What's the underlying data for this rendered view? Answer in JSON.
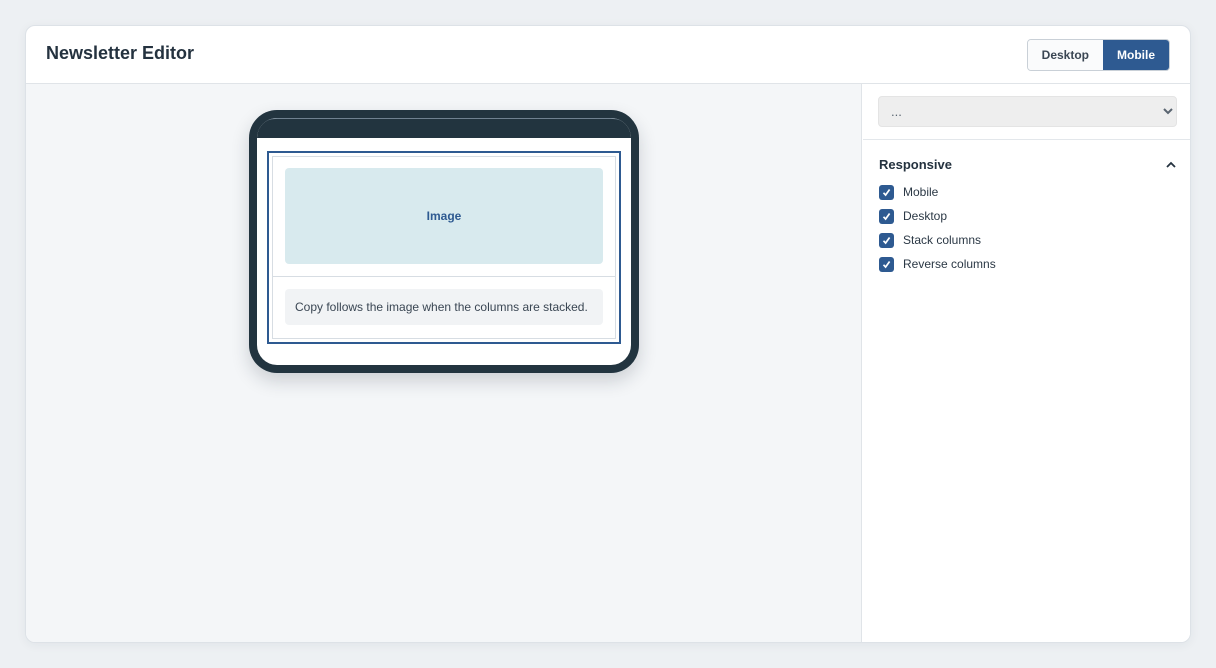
{
  "header": {
    "title": "Newsletter Editor",
    "view_toggle": {
      "desktop_label": "Desktop",
      "mobile_label": "Mobile",
      "active": "Mobile"
    }
  },
  "canvas": {
    "block": {
      "image_label": "Image",
      "copy_text": "Copy follows the image when the columns are stacked."
    }
  },
  "sidebar": {
    "block_select": {
      "value": "..."
    },
    "responsive": {
      "title": "Responsive",
      "options": [
        {
          "label": "Mobile",
          "checked": true
        },
        {
          "label": "Desktop",
          "checked": true
        },
        {
          "label": "Stack columns",
          "checked": true
        },
        {
          "label": "Reverse columns",
          "checked": true
        }
      ]
    }
  },
  "colors": {
    "accent": "#2e5a91",
    "phone_frame": "#22343f",
    "image_placeholder": "#d8eaee"
  },
  "icons": {
    "collapse": "chevron-up-icon",
    "checkbox": "check-icon",
    "select_arrow": "chevron-down-icon"
  }
}
